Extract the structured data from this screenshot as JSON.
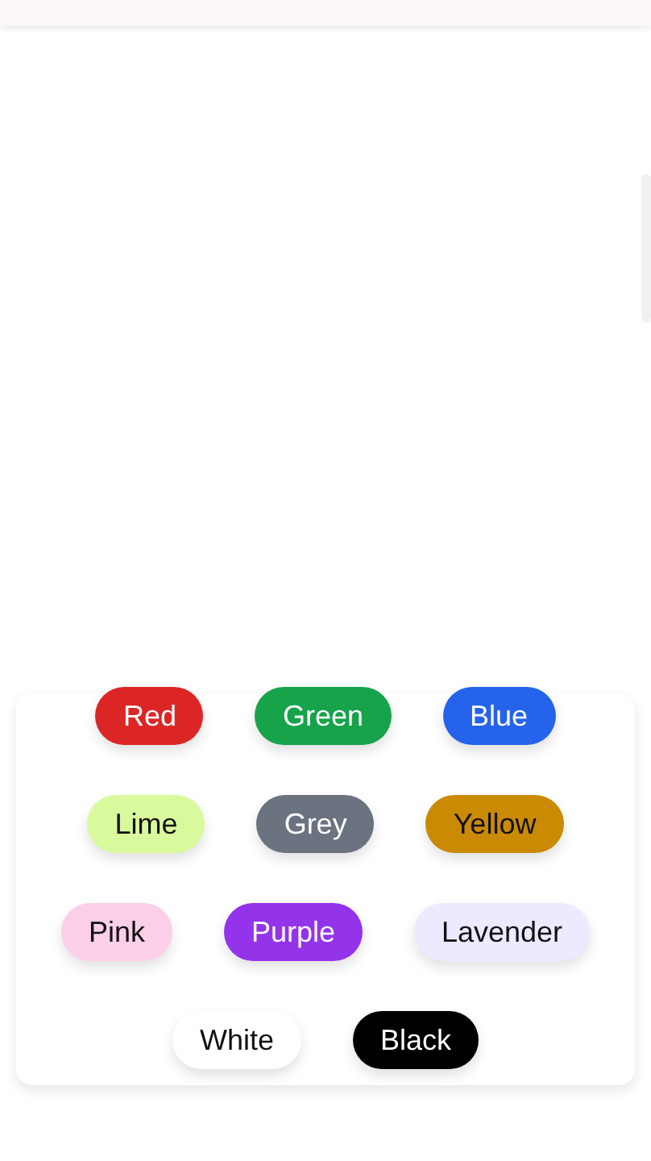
{
  "chip_rows": [
    {
      "chips": [
        {
          "label": "Red",
          "color": "#dc2626"
        },
        {
          "label": "Green",
          "color": "#16a34a"
        },
        {
          "label": "Blue",
          "color": "#2563eb"
        }
      ]
    },
    {
      "chips": [
        {
          "label": "Lime",
          "color": "#d9f99d"
        },
        {
          "label": "Grey",
          "color": "#6b7280"
        },
        {
          "label": "Yellow",
          "color": "#ca8a04"
        }
      ]
    },
    {
      "chips": [
        {
          "label": "Pink",
          "color": "#fbcfe8"
        },
        {
          "label": "Purple",
          "color": "#9333ea"
        },
        {
          "label": "Lavender",
          "color": "#ede9fe"
        }
      ]
    },
    {
      "chips": [
        {
          "label": "White",
          "color": "#ffffff"
        },
        {
          "label": "Black",
          "color": "#000000"
        }
      ]
    }
  ]
}
